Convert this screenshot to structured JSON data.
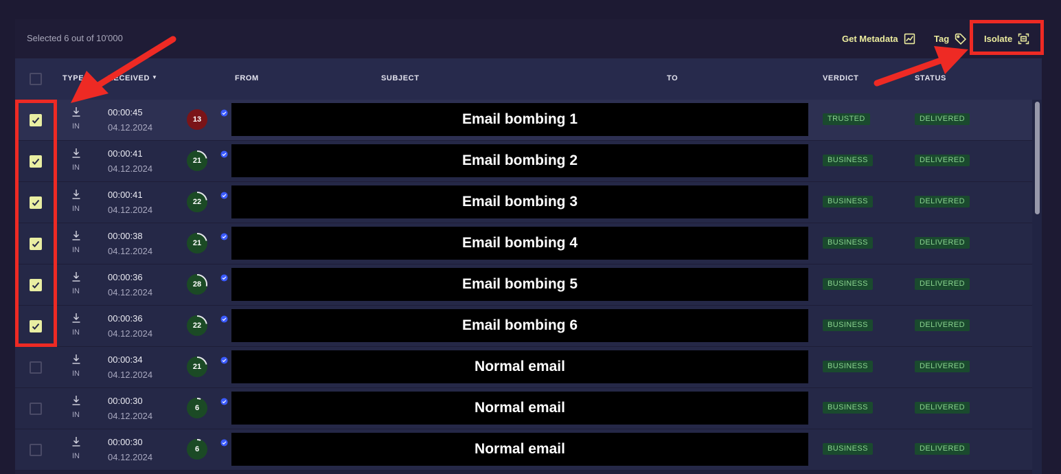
{
  "toolbar": {
    "selected_text": "Selected 6 out of 10'000",
    "get_metadata_label": "Get Metadata",
    "tag_label": "Tag",
    "isolate_label": "Isolate",
    "accent_color": "#ecec9e"
  },
  "columns": {
    "type": "TYPE",
    "received": "RECEIVED",
    "from": "FROM",
    "subject": "SUBJECT",
    "to": "TO",
    "verdict": "VERDICT",
    "status": "STATUS"
  },
  "rows": [
    {
      "checked": true,
      "type": "IN",
      "time": "00:00:45",
      "date": "04.12.2024",
      "score": "13",
      "score_level": "high",
      "score_fill": 0.0,
      "label": "Email bombing 1",
      "verdict": "TRUSTED",
      "status": "DELIVERED"
    },
    {
      "checked": true,
      "type": "IN",
      "time": "00:00:41",
      "date": "04.12.2024",
      "score": "21",
      "score_level": "normal",
      "score_fill": 0.21,
      "label": "Email bombing 2",
      "verdict": "BUSINESS",
      "status": "DELIVERED"
    },
    {
      "checked": true,
      "type": "IN",
      "time": "00:00:41",
      "date": "04.12.2024",
      "score": "22",
      "score_level": "normal",
      "score_fill": 0.22,
      "label": "Email bombing 3",
      "verdict": "BUSINESS",
      "status": "DELIVERED"
    },
    {
      "checked": true,
      "type": "IN",
      "time": "00:00:38",
      "date": "04.12.2024",
      "score": "21",
      "score_level": "normal",
      "score_fill": 0.21,
      "label": "Email bombing 4",
      "verdict": "BUSINESS",
      "status": "DELIVERED"
    },
    {
      "checked": true,
      "type": "IN",
      "time": "00:00:36",
      "date": "04.12.2024",
      "score": "28",
      "score_level": "normal",
      "score_fill": 0.28,
      "label": "Email bombing 5",
      "verdict": "BUSINESS",
      "status": "DELIVERED"
    },
    {
      "checked": true,
      "type": "IN",
      "time": "00:00:36",
      "date": "04.12.2024",
      "score": "22",
      "score_level": "normal",
      "score_fill": 0.22,
      "label": "Email bombing 6",
      "verdict": "BUSINESS",
      "status": "DELIVERED"
    },
    {
      "checked": false,
      "type": "IN",
      "time": "00:00:34",
      "date": "04.12.2024",
      "score": "21",
      "score_level": "normal",
      "score_fill": 0.21,
      "label": "Normal email",
      "verdict": "BUSINESS",
      "status": "DELIVERED"
    },
    {
      "checked": false,
      "type": "IN",
      "time": "00:00:30",
      "date": "04.12.2024",
      "score": "6",
      "score_level": "normal",
      "score_fill": 0.06,
      "label": "Normal email",
      "verdict": "BUSINESS",
      "status": "DELIVERED"
    },
    {
      "checked": false,
      "type": "IN",
      "time": "00:00:30",
      "date": "04.12.2024",
      "score": "6",
      "score_level": "normal",
      "score_fill": 0.06,
      "label": "Normal email",
      "verdict": "BUSINESS",
      "status": "DELIVERED"
    }
  ],
  "colors": {
    "checkbox_on": "#e9eea2",
    "badge_bg": "#1a4a2e",
    "badge_text": "#8ad48f",
    "score_high": "#7a1418",
    "score_normal": "#1b4a25",
    "annotation": "#ee2a24",
    "verified": "#3b5bff"
  },
  "icons": {
    "metadata": "chart-icon",
    "tag": "tag-icon",
    "isolate": "isolate-icon",
    "type": "download-icon",
    "verified": "verified-check-icon"
  }
}
